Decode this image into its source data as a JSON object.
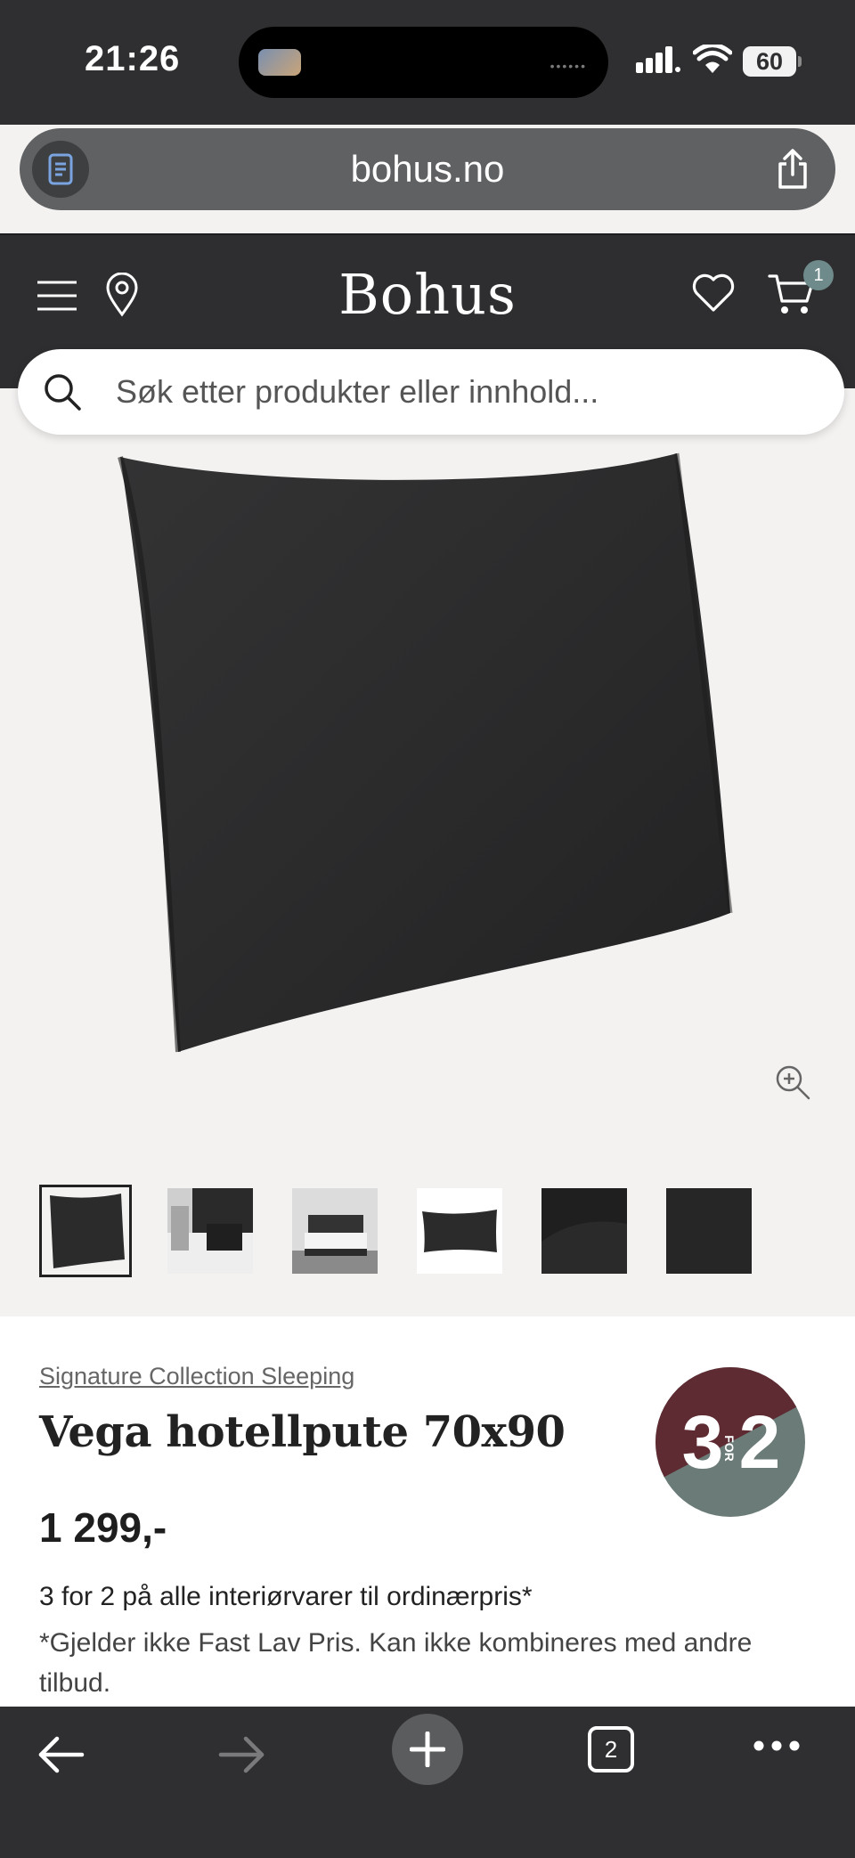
{
  "status_bar": {
    "time": "21:26",
    "battery": "60"
  },
  "browser": {
    "url": "bohus.no"
  },
  "site": {
    "logo": "Bohus",
    "cart_count": "1",
    "search_placeholder": "Søk etter produkter eller innhold..."
  },
  "product": {
    "collection": "Signature Collection Sleeping",
    "title": "Vega hotellpute 70x90",
    "price": "1 299,-",
    "promo": "3 for 2 på alle interiørvarer til ordinærpris*",
    "promo_note": "*Gjelder ikke Fast Lav Pris. Kan ikke kombineres med andre tilbud.",
    "badge": {
      "left": "3",
      "middle": "FOR",
      "right": "2",
      "color_top": "#5e2b32",
      "color_bottom": "#6b7b78"
    },
    "thumbnails": [
      "pillow-front",
      "bed-lifestyle-closeup",
      "bedroom-lifestyle",
      "pillow-flat",
      "fabric-texture-dark",
      "fabric-texture-darker"
    ]
  },
  "toolbar": {
    "tab_count": "2"
  },
  "colors": {
    "header_bg": "#2e2e30",
    "page_bg": "#f4f2f1",
    "badge_accent": "#6e8a8a"
  }
}
